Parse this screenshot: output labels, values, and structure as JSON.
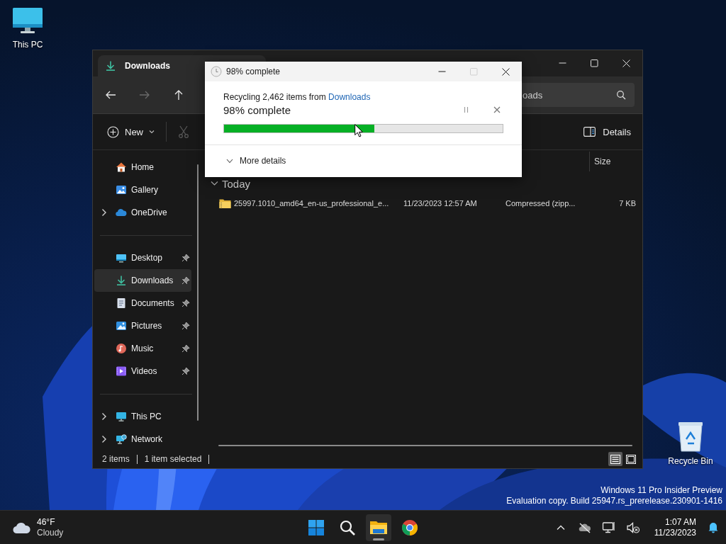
{
  "desktop": {
    "icons": [
      {
        "kind": "thispc",
        "label": "This PC"
      },
      {
        "kind": "recycle",
        "label": "Recycle Bin"
      }
    ],
    "watermark": [
      "Windows 11 Pro Insider Preview",
      "Evaluation copy. Build 25947.rs_prerelease.230901-1416"
    ]
  },
  "explorer": {
    "tab": {
      "kind": "downloads",
      "label": "Downloads"
    },
    "window_controls": [
      {
        "kind": "minimize"
      },
      {
        "kind": "maximize"
      },
      {
        "kind": "close"
      }
    ],
    "nav": [
      {
        "kind": "back",
        "disabled": false
      },
      {
        "kind": "forward",
        "disabled": true
      },
      {
        "kind": "up",
        "disabled": false
      }
    ],
    "search": {
      "value": "oads"
    },
    "toolbar": {
      "new_label": "New",
      "cut_disabled": true,
      "details_label": "Details"
    },
    "sidebar": [
      {
        "items": [
          {
            "kind": "home",
            "label": "Home",
            "pinned": false,
            "selected": false
          },
          {
            "kind": "gallery",
            "label": "Gallery",
            "pinned": false,
            "selected": false
          },
          {
            "kind": "onedrive",
            "label": "OneDrive",
            "pinned": false,
            "selected": false,
            "expanded": false
          }
        ]
      },
      {
        "items": [
          {
            "kind": "desktop",
            "label": "Desktop",
            "pinned": true,
            "selected": false
          },
          {
            "kind": "downloads",
            "label": "Downloads",
            "pinned": true,
            "selected": true
          },
          {
            "kind": "documents",
            "label": "Documents",
            "pinned": true,
            "selected": false
          },
          {
            "kind": "pictures",
            "label": "Pictures",
            "pinned": true,
            "selected": false
          },
          {
            "kind": "music",
            "label": "Music",
            "pinned": true,
            "selected": false
          },
          {
            "kind": "videos",
            "label": "Videos",
            "pinned": true,
            "selected": false
          }
        ]
      },
      {
        "items": [
          {
            "kind": "thispc",
            "label": "This PC",
            "pinned": false,
            "selected": false,
            "expanded": false
          },
          {
            "kind": "network",
            "label": "Network",
            "pinned": false,
            "selected": false,
            "expanded": false
          }
        ]
      }
    ],
    "columns": [
      {
        "label": "Size"
      }
    ],
    "group": {
      "label": "Today",
      "expanded": true
    },
    "rows": [
      {
        "name": "25997.1010_amd64_en-us_professional_e...",
        "date": "11/23/2023 12:57 AM",
        "type": "Compressed (zipp...",
        "size": "7 KB"
      }
    ],
    "status": [
      "2 items",
      "1 item selected"
    ],
    "views": [
      {
        "kind": "details",
        "selected": true
      },
      {
        "kind": "tiles",
        "selected": false
      }
    ]
  },
  "dialog": {
    "title": "98% complete",
    "controls": [
      {
        "kind": "minimize",
        "disabled": false
      },
      {
        "kind": "maximize",
        "disabled": true
      },
      {
        "kind": "close",
        "disabled": false
      }
    ],
    "message": "Recycling 2,462 items from",
    "source_link": "Downloads",
    "progress_text": "98% complete",
    "progress": {
      "level": 0.54
    },
    "more_details": "More details"
  },
  "taskbar": {
    "weather": {
      "temp": "46°F",
      "condition": "Cloudy"
    },
    "apps": [
      {
        "kind": "start",
        "active": false
      },
      {
        "kind": "search",
        "active": false
      },
      {
        "kind": "explorer",
        "active": true
      },
      {
        "kind": "chrome",
        "active": false
      }
    ],
    "tray": [
      {
        "kind": "chevron"
      },
      {
        "kind": "onedrive-off"
      },
      {
        "kind": "network"
      },
      {
        "kind": "volume-muted"
      }
    ],
    "time": "1:07 AM",
    "date": "11/23/2023"
  }
}
